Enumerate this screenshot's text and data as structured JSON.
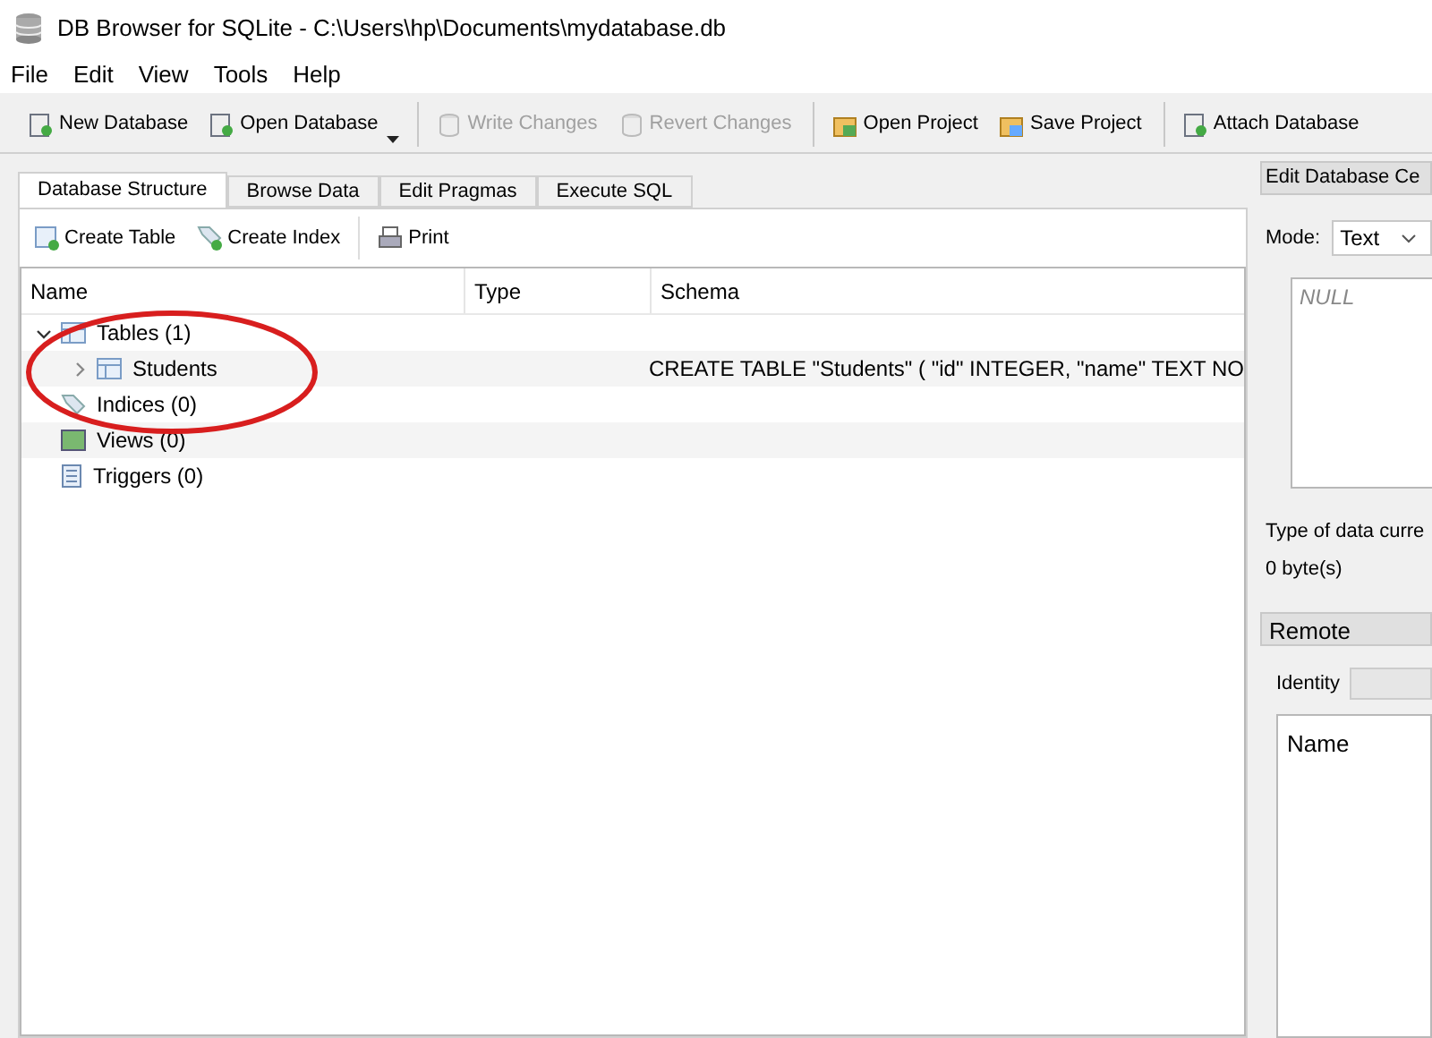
{
  "window": {
    "title": "DB Browser for SQLite - C:\\Users\\hp\\Documents\\mydatabase.db"
  },
  "menu": [
    {
      "label": "File"
    },
    {
      "label": "Edit"
    },
    {
      "label": "View"
    },
    {
      "label": "Tools"
    },
    {
      "label": "Help"
    }
  ],
  "toolbar": [
    {
      "label": "New Database",
      "disabled": false,
      "dropdown": false,
      "separator_before": false
    },
    {
      "label": "Open Database",
      "disabled": false,
      "dropdown": true,
      "separator_before": false
    },
    {
      "label": "Write Changes",
      "disabled": true,
      "dropdown": false,
      "separator_before": true
    },
    {
      "label": "Revert Changes",
      "disabled": true,
      "dropdown": false,
      "separator_before": false
    },
    {
      "label": "Open Project",
      "disabled": false,
      "dropdown": false,
      "separator_before": true
    },
    {
      "label": "Save Project",
      "disabled": false,
      "dropdown": false,
      "separator_before": false
    },
    {
      "label": "Attach Database",
      "disabled": false,
      "dropdown": false,
      "separator_before": true
    }
  ],
  "tabs": [
    {
      "label": "Database Structure",
      "selected": true
    },
    {
      "label": "Browse Data",
      "selected": false
    },
    {
      "label": "Edit Pragmas",
      "selected": false
    },
    {
      "label": "Execute SQL",
      "selected": false
    }
  ],
  "structure_toolbar": [
    {
      "label": "Create Table"
    },
    {
      "label": "Create Index"
    },
    {
      "label": "Print"
    }
  ],
  "tree": {
    "columns": [
      "Name",
      "Type",
      "Schema"
    ],
    "items": [
      {
        "name": "Tables (1)",
        "kind": "tables",
        "expanded": true,
        "children": [
          {
            "name": "Students",
            "kind": "table",
            "expanded": false,
            "schema": "CREATE TABLE \"Students\" ( \"id\" INTEGER, \"name\" TEXT NO"
          }
        ]
      },
      {
        "name": "Indices (0)",
        "kind": "indices"
      },
      {
        "name": "Views (0)",
        "kind": "views"
      },
      {
        "name": "Triggers (0)",
        "kind": "triggers"
      }
    ]
  },
  "edit_cell": {
    "title": "Edit Database Ce",
    "mode_label": "Mode:",
    "mode": "Text",
    "value_placeholder": "NULL",
    "type_info": "Type of data curre",
    "size_info": "0 byte(s)"
  },
  "remote": {
    "title": "Remote",
    "identity_label": "Identity",
    "list_header": "Name"
  }
}
